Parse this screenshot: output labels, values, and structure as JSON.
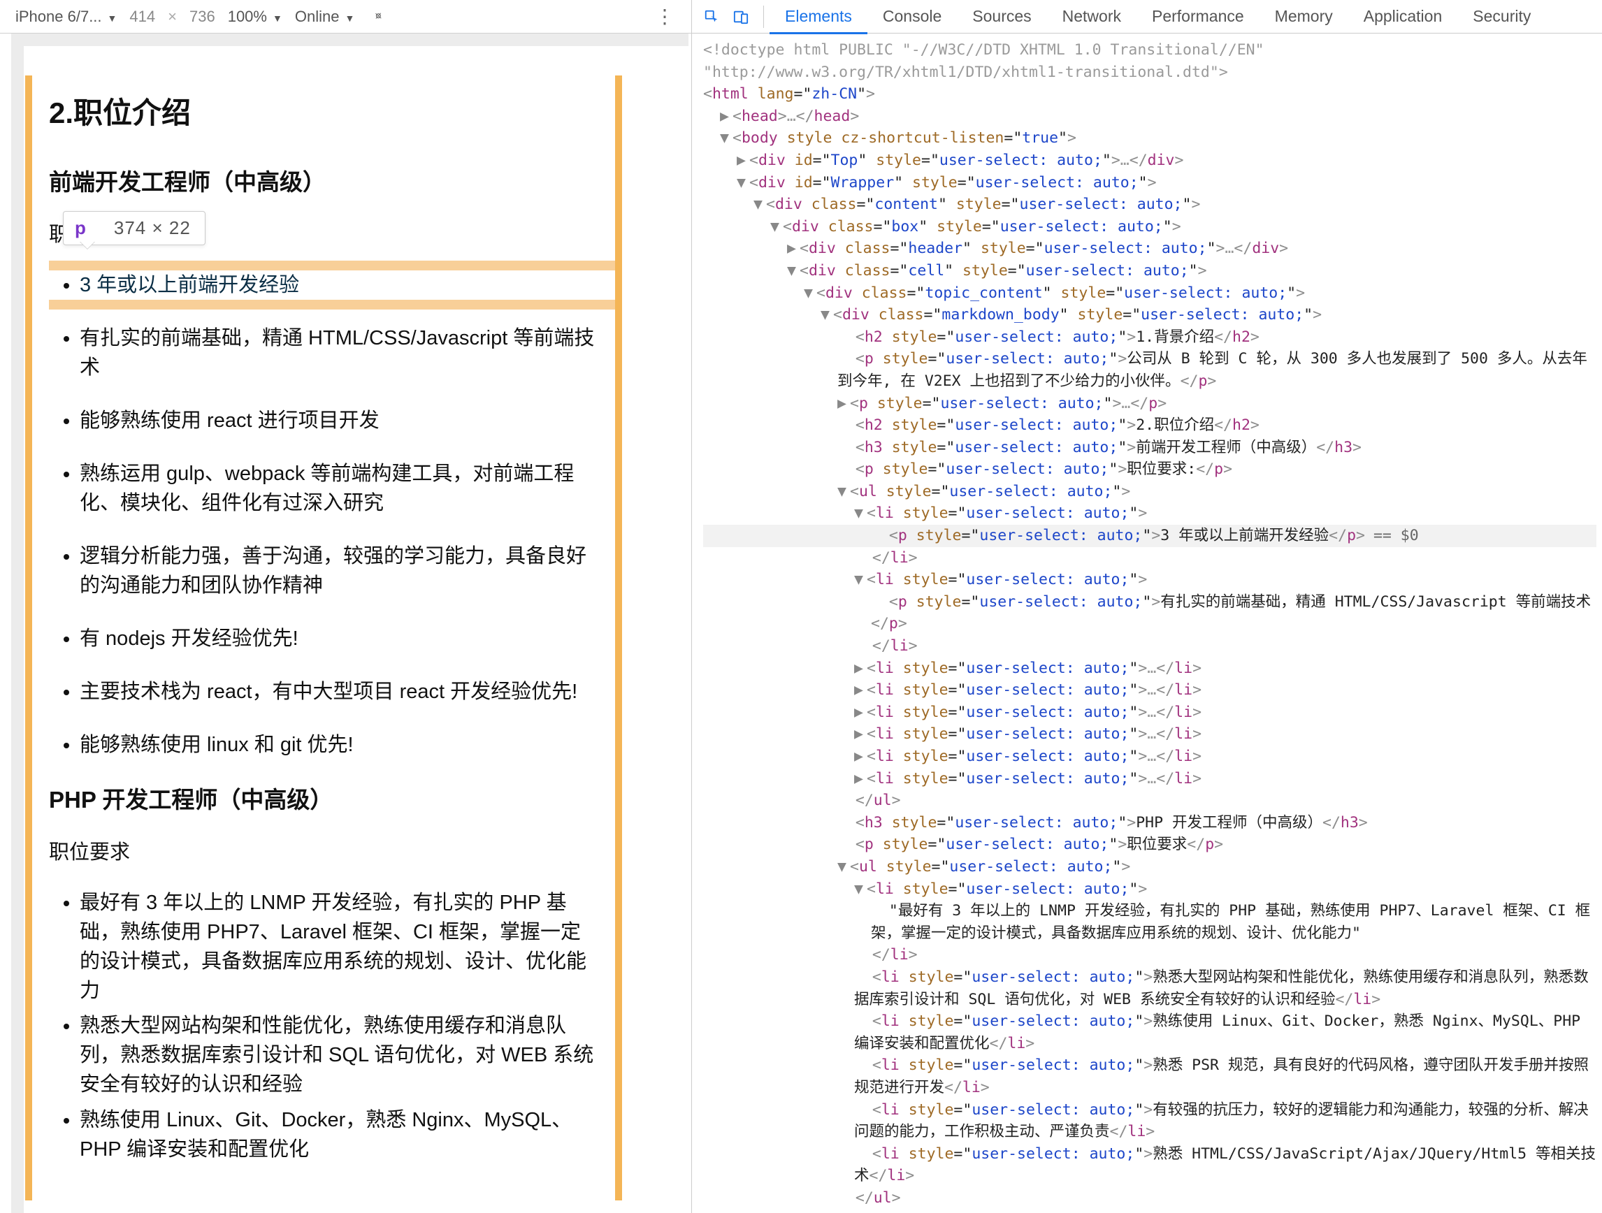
{
  "toolbar": {
    "device": "iPhone 6/7...",
    "vp_w": "414",
    "vp_h": "736",
    "zoom": "100%",
    "network": "Online"
  },
  "tooltip": {
    "tag": "p",
    "dims": "374 × 22"
  },
  "page": {
    "h2": "2.职位介绍",
    "fe_title": "前端开发工程师（中高级）",
    "req_label_short": "职位",
    "req_label": "职位要求",
    "fe_items": [
      "3 年或以上前端开发经验",
      "有扎实的前端基础，精通 HTML/CSS/Javascript 等前端技术",
      "能够熟练使用 react 进行项目开发",
      "熟练运用 gulp、webpack 等前端构建工具，对前端工程化、模块化、组件化有过深入研究",
      "逻辑分析能力强，善于沟通，较强的学习能力，具备良好的沟通能力和团队协作精神",
      "有 nodejs 开发经验优先!",
      "主要技术栈为 react，有中大型项目 react 开发经验优先!",
      "能够熟练使用 linux 和 git 优先!"
    ],
    "php_title": "PHP 开发工程师（中高级）",
    "php_items": [
      "最好有 3 年以上的 LNMP 开发经验，有扎实的 PHP 基础，熟练使用 PHP7、Laravel 框架、CI 框架，掌握一定的设计模式，具备数据库应用系统的规划、设计、优化能力",
      "熟悉大型网站构架和性能优化，熟练使用缓存和消息队列，熟悉数据库索引设计和 SQL 语句优化，对 WEB 系统安全有较好的认识和经验",
      "熟练使用 Linux、Git、Docker，熟悉 Nginx、MySQL、PHP 编译安装和配置优化"
    ]
  },
  "devtools_tabs": [
    "Elements",
    "Console",
    "Sources",
    "Network",
    "Performance",
    "Memory",
    "Application",
    "Security"
  ],
  "dom": {
    "doctype1": "<!doctype html PUBLIC \"-//W3C//DTD XHTML 1.0 Transitional//EN\"",
    "doctype2": "\"http://www.w3.org/TR/xhtml1/DTD/xhtml1-transitional.dtd\">",
    "html_lang": "zh-CN",
    "body_attr": "cz-shortcut-listen",
    "body_attr_v": "true",
    "top_id": "Top",
    "wrap_id": "Wrapper",
    "c_content": "content",
    "c_box": "box",
    "c_header": "header",
    "c_cell": "cell",
    "c_topic": "topic_content",
    "c_md": "markdown_body",
    "style_auto": "user-select: auto;",
    "h2_text": "1.背景介绍",
    "p1_text": "公司从 B 轮到 C 轮，从 300 多人也发展到了 500 多人。从去年到今年, 在 V2EX 上也招到了不少给力的小伙伴。",
    "h2b_text": "2.职位介绍",
    "h3a_text": "前端开发工程师（中高级）",
    "p_req_a": "职位要求:",
    "li1_text": "3 年或以上前端开发经验",
    "li2_text": "有扎实的前端基础，精通 HTML/CSS/Javascript 等前端技术",
    "h3b_text": "PHP 开发工程师（中高级）",
    "p_req_b": "职位要求",
    "php_li1": "\"最好有 3 年以上的 LNMP 开发经验，有扎实的 PHP 基础，熟练使用 PHP7、Laravel 框架、CI 框架，掌握一定的设计模式，具备数据库应用系统的规划、设计、优化能力\"",
    "php_li2": "熟悉大型网站构架和性能优化，熟练使用缓存和消息队列，熟悉数据库索引设计和 SQL 语句优化，对 WEB 系统安全有较好的认识和经验",
    "php_li3": "熟练使用 Linux、Git、Docker，熟悉 Nginx、MySQL、PHP 编译安装和配置优化",
    "php_li4": "熟悉 PSR 规范，具有良好的代码风格，遵守团队开发手册并按照规范进行开发",
    "php_li5": "有较强的抗压力，较好的逻辑能力和沟通能力，较强的分析、解决问题的能力，工作积极主动、严谨负责",
    "php_li6": "熟悉 HTML/CSS/JavaScript/Ajax/JQuery/Html5 等相关技术",
    "eq_sel": "== $0"
  }
}
